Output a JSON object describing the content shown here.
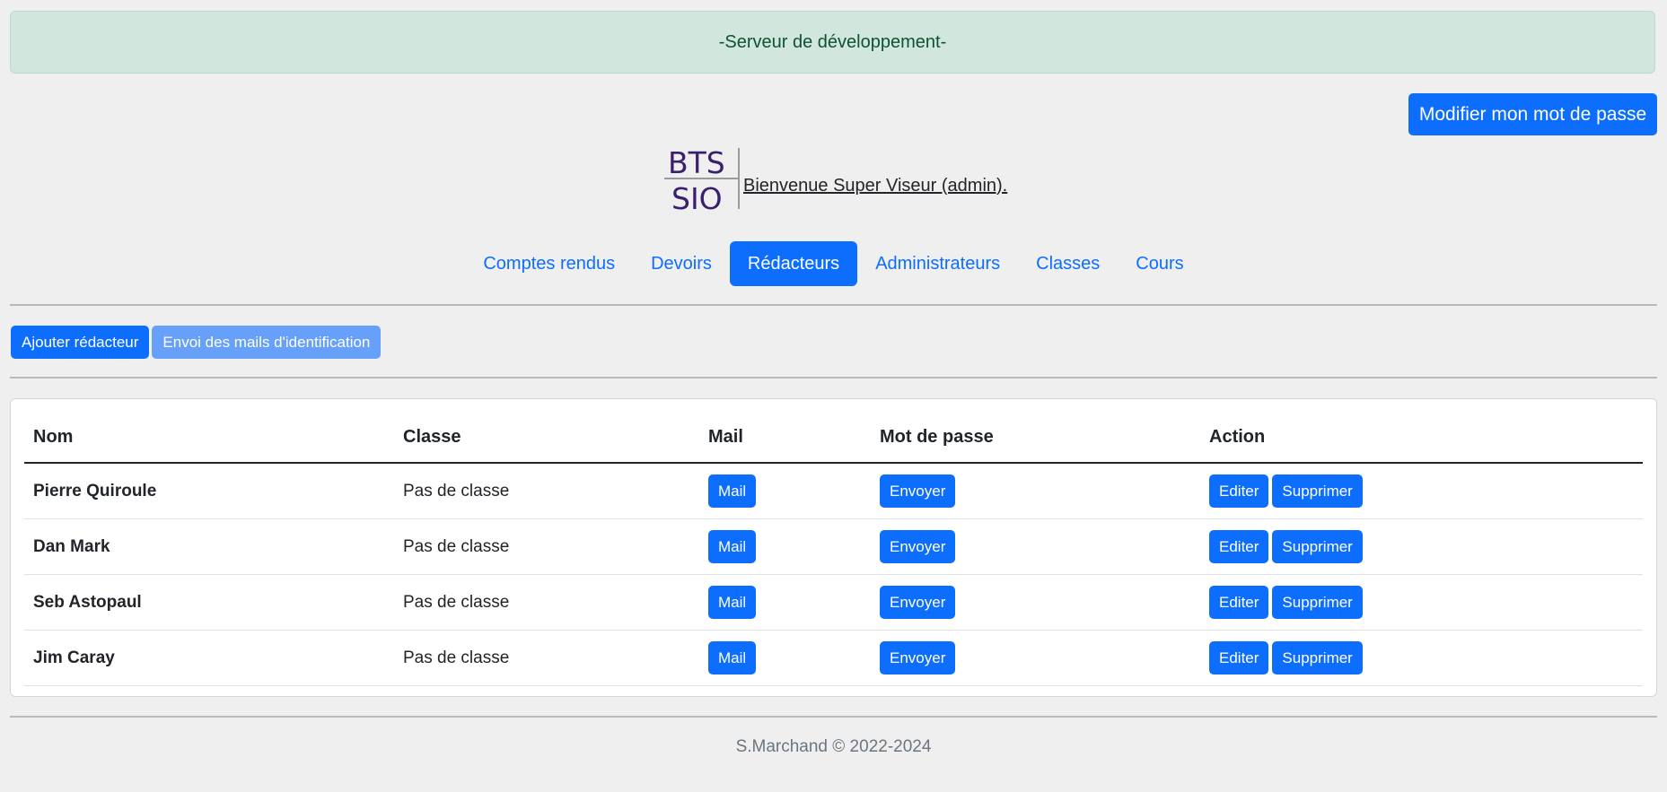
{
  "banner": {
    "text": "-Serveur de développement-"
  },
  "header": {
    "password_button": "Modifier mon mot de passe",
    "logo": {
      "line1": "BTS",
      "line2": "SIO"
    },
    "welcome": "Bienvenue Super Viseur (admin)."
  },
  "nav": {
    "items": [
      {
        "label": "Comptes rendus",
        "active": false
      },
      {
        "label": "Devoirs",
        "active": false
      },
      {
        "label": "Rédacteurs",
        "active": true
      },
      {
        "label": "Administrateurs",
        "active": false
      },
      {
        "label": "Classes",
        "active": false
      },
      {
        "label": "Cours",
        "active": false
      }
    ]
  },
  "toolbar": {
    "add_label": "Ajouter rédacteur",
    "send_mails_label": "Envoi des mails d'identification"
  },
  "table": {
    "headers": {
      "name": "Nom",
      "class": "Classe",
      "mail": "Mail",
      "password": "Mot de passe",
      "action": "Action"
    },
    "rows": [
      {
        "name": "Pierre Quiroule",
        "class": "Pas de classe",
        "mail_btn": "Mail",
        "send_btn": "Envoyer",
        "edit_btn": "Editer",
        "delete_btn": "Supprimer"
      },
      {
        "name": "Dan Mark",
        "class": "Pas de classe",
        "mail_btn": "Mail",
        "send_btn": "Envoyer",
        "edit_btn": "Editer",
        "delete_btn": "Supprimer"
      },
      {
        "name": "Seb Astopaul",
        "class": "Pas de classe",
        "mail_btn": "Mail",
        "send_btn": "Envoyer",
        "edit_btn": "Editer",
        "delete_btn": "Supprimer"
      },
      {
        "name": "Jim Caray",
        "class": "Pas de classe",
        "mail_btn": "Mail",
        "send_btn": "Envoyer",
        "edit_btn": "Editer",
        "delete_btn": "Supprimer"
      }
    ]
  },
  "footer": {
    "text": "S.Marchand © 2022-2024"
  },
  "colors": {
    "primary": "#0d6efd",
    "banner_bg": "#d1e7dd",
    "banner_text": "#0f5132",
    "page_bg": "#efefef",
    "logo_text": "#3a1f6e"
  }
}
